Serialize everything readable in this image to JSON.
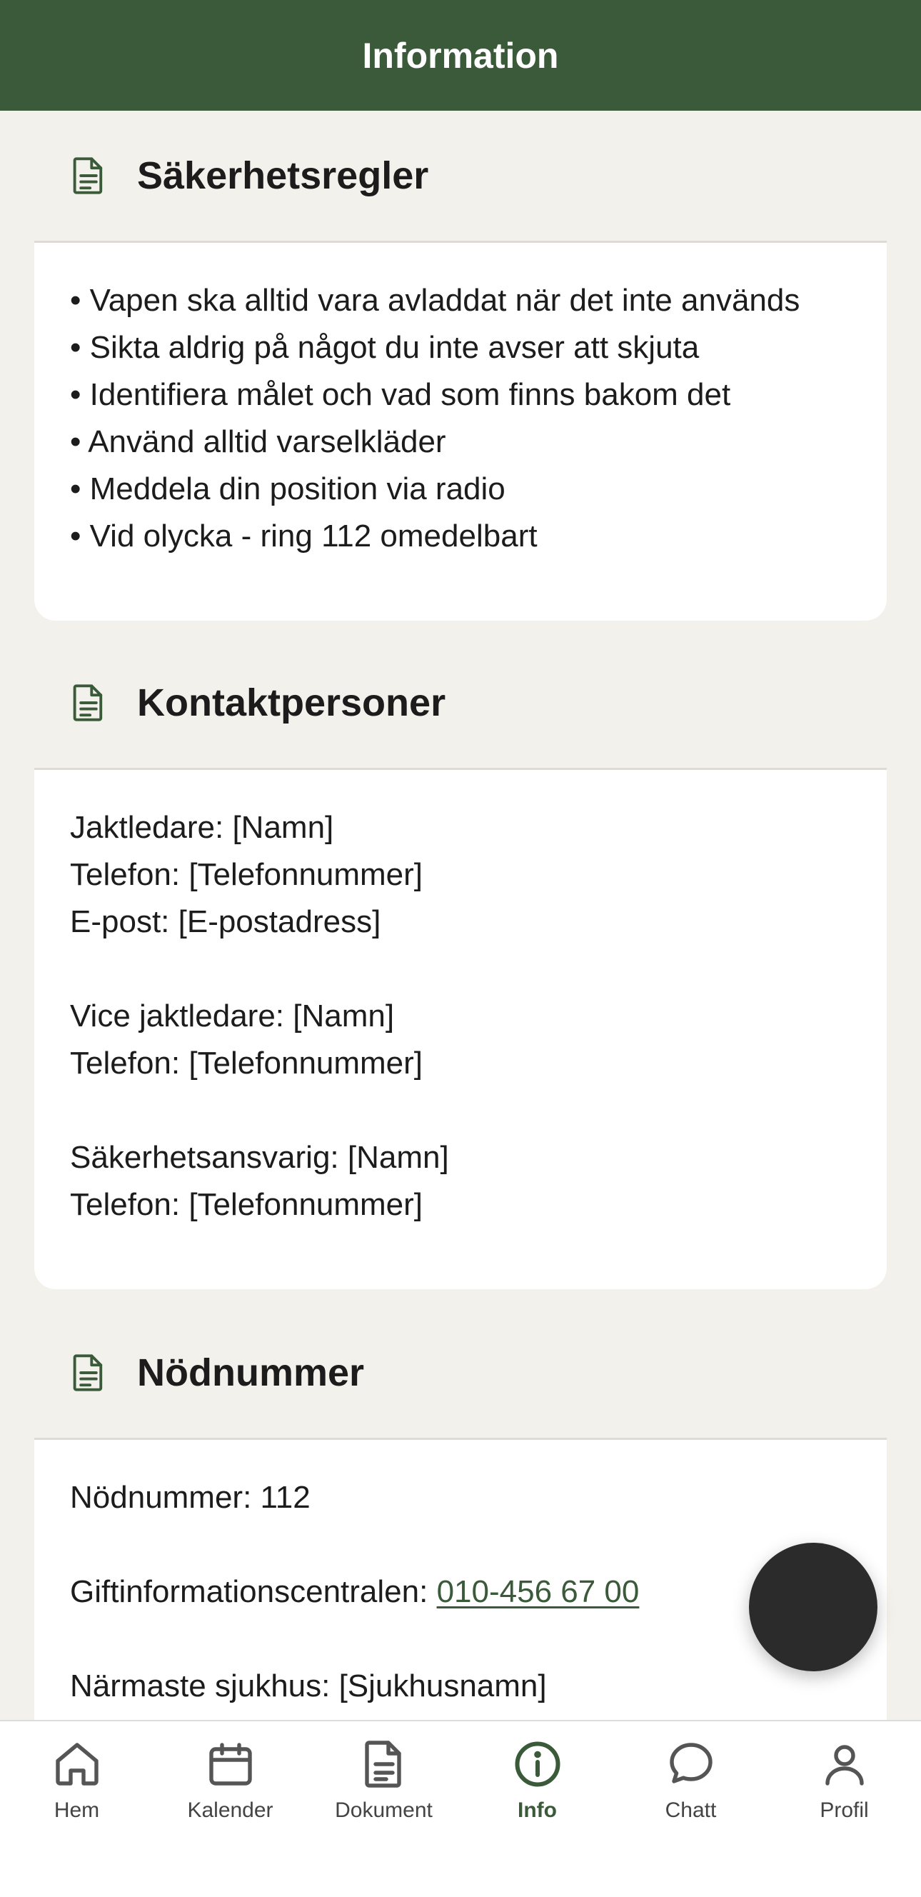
{
  "header": {
    "title": "Information"
  },
  "sections": {
    "safety": {
      "title": "Säkerhetsregler",
      "icon": "document-icon",
      "lines": [
        "• Vapen ska alltid vara avladdat när det inte används",
        "• Sikta aldrig på något du inte avser att skjuta",
        "• Identifiera målet och vad som finns bakom det",
        "• Använd alltid varselkläder",
        "• Meddela din position via radio",
        "• Vid olycka - ring 112 omedelbart"
      ]
    },
    "contacts": {
      "title": "Kontaktpersoner",
      "icon": "document-icon",
      "leader": [
        "Jaktledare: [Namn]",
        "Telefon: [Telefonnummer]",
        "E-post: [E-postadress]"
      ],
      "vice": [
        "Vice jaktledare: [Namn]",
        "Telefon: [Telefonnummer]"
      ],
      "safety_officer": [
        "Säkerhetsansvarig: [Namn]",
        "Telefon: [Telefonnummer]"
      ]
    },
    "emergency": {
      "title": "Nödnummer",
      "icon": "document-icon",
      "emergency_line": "Nödnummer: 112",
      "poison_label": "Giftinformationscentralen: ",
      "poison_number": "010-456 67 00",
      "hospital_line": "Närmaste sjukhus: [Sjukhusnamn]"
    }
  },
  "tabs": [
    {
      "label": "Hem",
      "icon": "home-icon"
    },
    {
      "label": "Kalender",
      "icon": "calendar-icon"
    },
    {
      "label": "Dokument",
      "icon": "document-icon"
    },
    {
      "label": "Info",
      "icon": "info-icon",
      "active": true
    },
    {
      "label": "Chatt",
      "icon": "chat-bubble-icon"
    },
    {
      "label": "Profil",
      "icon": "person-icon"
    }
  ],
  "colors": {
    "primary": "#3a5a3a",
    "background": "#f3f1ec",
    "card": "#ffffff",
    "fab": "#2b2b2b"
  }
}
